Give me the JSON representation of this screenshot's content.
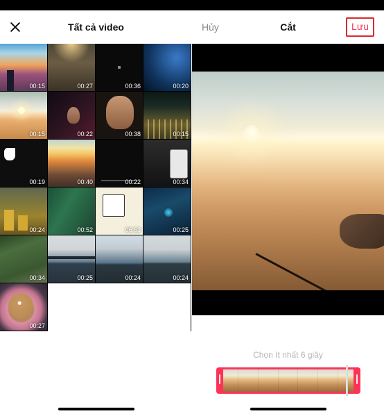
{
  "left": {
    "title": "Tất cả video",
    "thumbs": [
      {
        "dur": "00:15",
        "art": "sunset-city"
      },
      {
        "dur": "00:27",
        "art": "forest-road"
      },
      {
        "dur": "00:36",
        "art": "dark-panel"
      },
      {
        "dur": "00:20",
        "art": "light-show"
      },
      {
        "dur": "00:15",
        "art": "desert-sun"
      },
      {
        "dur": "00:22",
        "art": "dancer"
      },
      {
        "dur": "00:38",
        "art": "guy-face"
      },
      {
        "dur": "00:15",
        "art": "city-night"
      },
      {
        "dur": "00:19",
        "art": "tiktok-dark"
      },
      {
        "dur": "00:40",
        "art": "sunset-bridge"
      },
      {
        "dur": "00:22",
        "art": "dark-ui"
      },
      {
        "dur": "00:34",
        "art": "phone-shot"
      },
      {
        "dur": "00:24",
        "art": "gold-bars"
      },
      {
        "dur": "00:52",
        "art": "game1"
      },
      {
        "dur": "06:53",
        "art": "comic"
      },
      {
        "dur": "00:25",
        "art": "game2"
      },
      {
        "dur": "00:34",
        "art": "leaves"
      },
      {
        "dur": "00:25",
        "art": "bench1"
      },
      {
        "dur": "00:24",
        "art": "bench2"
      },
      {
        "dur": "00:24",
        "art": "bench3"
      },
      {
        "dur": "00:27",
        "art": "coffee"
      }
    ]
  },
  "right": {
    "cancel": "Hủy",
    "title": "Cắt",
    "save": "Lưu",
    "hint": "Chọn ít nhất 6 giây",
    "timeline_frames": 7
  }
}
